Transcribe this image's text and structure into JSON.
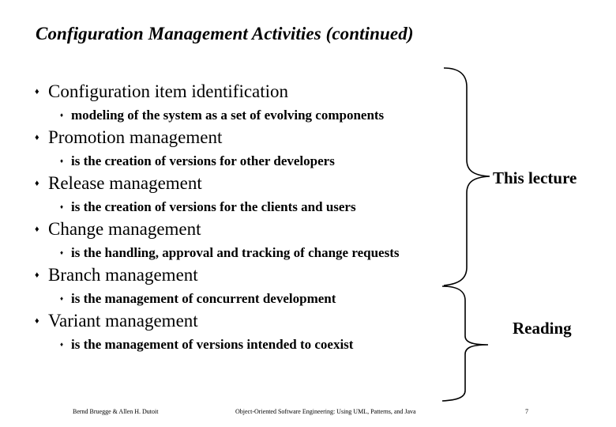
{
  "slide": {
    "title": "Configuration Management Activities (continued)",
    "bullet_icon": "diamond",
    "sub_bullet_icon": "small-diamond",
    "items": [
      {
        "label": "Configuration item identification",
        "sub": "modeling of the system as a set of evolving components"
      },
      {
        "label": "Promotion management",
        "sub": "is the creation of versions for other developers"
      },
      {
        "label": "Release management",
        "sub": "is the creation of versions for the clients and users"
      },
      {
        "label": "Change management",
        "sub": "is the handling, approval and tracking of change requests"
      },
      {
        "label": "Branch management",
        "sub": "is the management of concurrent development"
      },
      {
        "label": "Variant management",
        "sub": "is the management of versions intended to coexist"
      }
    ],
    "groups": [
      {
        "label": "This lecture",
        "brace_icon": "right-curly-brace"
      },
      {
        "label": "Reading",
        "brace_icon": "right-curly-brace"
      }
    ],
    "footer": {
      "authors": "Bernd Bruegge & Allen H. Dutoit",
      "book": "Object-Oriented Software Engineering: Using UML, Patterns, and Java",
      "page": "7"
    }
  }
}
